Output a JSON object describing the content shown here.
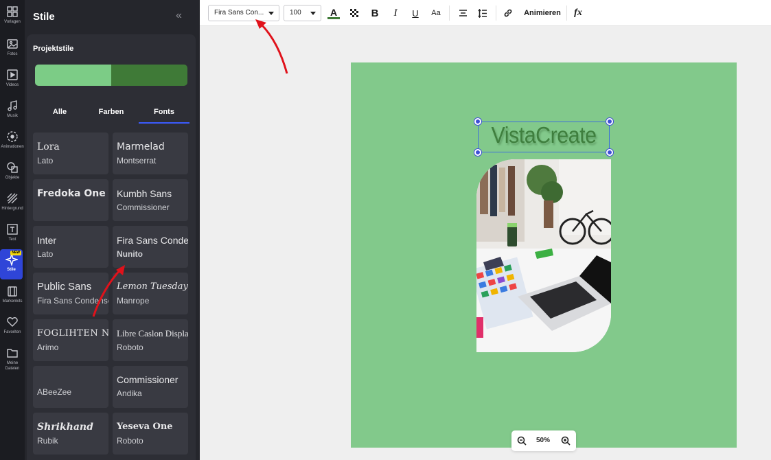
{
  "rail": {
    "items": [
      {
        "label": "Vorlagen",
        "icon": "grid-icon"
      },
      {
        "label": "Fotos",
        "icon": "photo-icon"
      },
      {
        "label": "Videos",
        "icon": "video-icon"
      },
      {
        "label": "Musik",
        "icon": "music-icon"
      },
      {
        "label": "Animationen",
        "icon": "animation-icon"
      },
      {
        "label": "Objekte",
        "icon": "shapes-icon"
      },
      {
        "label": "Hintergrund",
        "icon": "background-icon"
      },
      {
        "label": "Text",
        "icon": "text-icon"
      },
      {
        "label": "Stile",
        "icon": "sparkle-icon",
        "badge": "NEW"
      },
      {
        "label": "Markenkits",
        "icon": "brandkit-icon"
      },
      {
        "label": "Favoriten",
        "icon": "heart-icon"
      },
      {
        "label": "Meine Dateien",
        "icon": "folder-icon"
      }
    ]
  },
  "panel": {
    "title": "Stile",
    "section_label": "Projektstile",
    "palette": [
      "#7ccc86",
      "#3f7a37"
    ],
    "tabs": [
      {
        "label": "Alle"
      },
      {
        "label": "Farben"
      },
      {
        "label": "Fonts",
        "active": true
      }
    ],
    "font_pairs": [
      {
        "heading": "Lora",
        "body": "Lato"
      },
      {
        "heading": "Marmelad",
        "body": "Montserrat"
      },
      {
        "heading": "Fredoka One",
        "body": ""
      },
      {
        "heading": "Kumbh Sans",
        "body": "Commissioner"
      },
      {
        "heading": "Inter",
        "body": "Lato"
      },
      {
        "heading": "Fira Sans Condensed",
        "body": "Nunito"
      },
      {
        "heading": "Public Sans",
        "body": "Fira Sans Condensed"
      },
      {
        "heading": "Lemon Tuesday",
        "body": "Manrope"
      },
      {
        "heading": "FOGLIHTEN NO",
        "body": "Arimo"
      },
      {
        "heading": "Libre Caslon Display",
        "body": "Roboto"
      },
      {
        "heading": "",
        "body": "ABeeZee"
      },
      {
        "heading": "Commissioner",
        "body": "Andika"
      },
      {
        "heading": "Shrikhand",
        "body": "Rubik"
      },
      {
        "heading": "Yeseva One",
        "body": "Roboto"
      }
    ]
  },
  "toolbar": {
    "font_value": "Fira Sans Con...",
    "size_value": "100",
    "text_color": "#3f7a37",
    "animate_label": "Animieren"
  },
  "canvas": {
    "background": "#82c98b",
    "headline": "VistaCreate",
    "headline_color": "#3f7f3e",
    "zoom_label": "50%"
  },
  "colors": {
    "accent": "#2f45d8",
    "selection": "#3d4fd6",
    "annotation_arrow": "#e0121b"
  }
}
